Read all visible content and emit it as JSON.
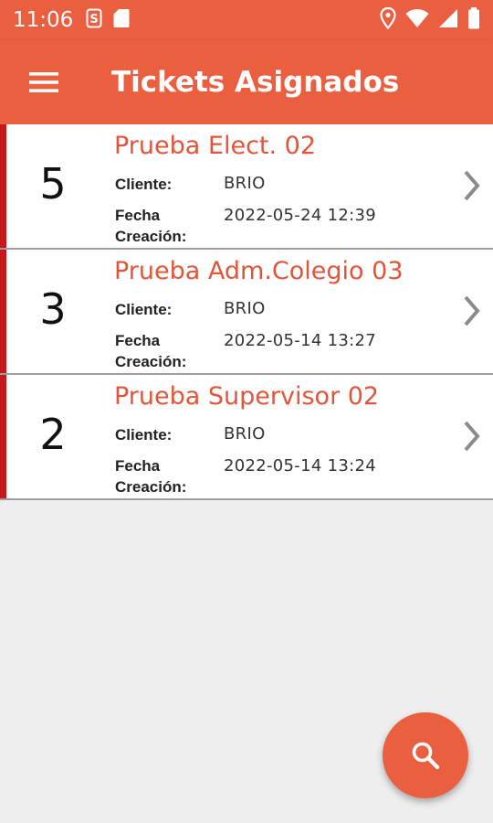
{
  "status_bar": {
    "time": "11:06",
    "icons": [
      "sim-s-icon",
      "sd-card-icon",
      "location-icon",
      "wifi-icon",
      "signal-icon",
      "battery-icon"
    ]
  },
  "app_bar": {
    "title": "Tickets Asignados",
    "menu_icon": "hamburger-menu-icon"
  },
  "colors": {
    "primary": "#ea5f3f",
    "accent_bar": "#c41a1a",
    "title_text": "#e2553a",
    "background": "#eeeeee"
  },
  "tickets": [
    {
      "count": "5",
      "title": "Prueba Elect. 02",
      "cliente_label": "Cliente:",
      "cliente": "BRIO",
      "fecha_label_1": "Fecha",
      "fecha_label_2": "Creación:",
      "fecha": "2022-05-24 12:39"
    },
    {
      "count": "3",
      "title": "Prueba Adm.Colegio 03",
      "cliente_label": "Cliente:",
      "cliente": "BRIO",
      "fecha_label_1": "Fecha",
      "fecha_label_2": "Creación:",
      "fecha": "2022-05-14 13:27"
    },
    {
      "count": "2",
      "title": "Prueba Supervisor 02",
      "cliente_label": "Cliente:",
      "cliente": "BRIO",
      "fecha_label_1": "Fecha",
      "fecha_label_2": "Creación:",
      "fecha": "2022-05-14 13:24"
    }
  ],
  "fab": {
    "icon": "search-icon"
  }
}
